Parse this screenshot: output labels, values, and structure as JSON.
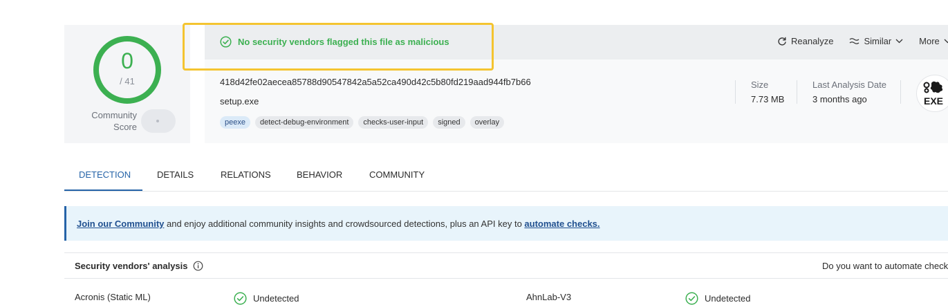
{
  "score": {
    "detections": "0",
    "total": "/ 41",
    "community_label_1": "Community",
    "community_label_2": "Score"
  },
  "banner": {
    "message": "No security vendors flagged this file as malicious"
  },
  "actions": {
    "reanalyze": "Reanalyze",
    "similar": "Similar",
    "more": "More"
  },
  "file": {
    "hash": "418d42fe02aecea85788d90547842a5a52ca490d42c5b80fd219aad944fb7b66",
    "name": "setup.exe",
    "tags": [
      "peexe",
      "detect-debug-environment",
      "checks-user-input",
      "signed",
      "overlay"
    ]
  },
  "meta": {
    "size_label": "Size",
    "size_value": "7.73 MB",
    "date_label": "Last Analysis Date",
    "date_value": "3 months ago",
    "type_badge": "EXE"
  },
  "tabs": [
    "DETECTION",
    "DETAILS",
    "RELATIONS",
    "BEHAVIOR",
    "COMMUNITY"
  ],
  "community_info": {
    "join_link": "Join our Community",
    "middle": " and enjoy additional community insights and crowdsourced detections, plus an API key to ",
    "automate_link": "automate checks."
  },
  "vendors": {
    "title": "Security vendors' analysis",
    "automate_prompt": "Do you want to automate checks?",
    "rows": [
      {
        "vendor_a": "Acronis (Static ML)",
        "status_a": "Undetected",
        "vendor_b": "AhnLab-V3",
        "status_b": "Undetected"
      }
    ]
  },
  "colors": {
    "clean": "#3cb051",
    "accent": "#2563a8",
    "highlight": "#f4c430"
  }
}
